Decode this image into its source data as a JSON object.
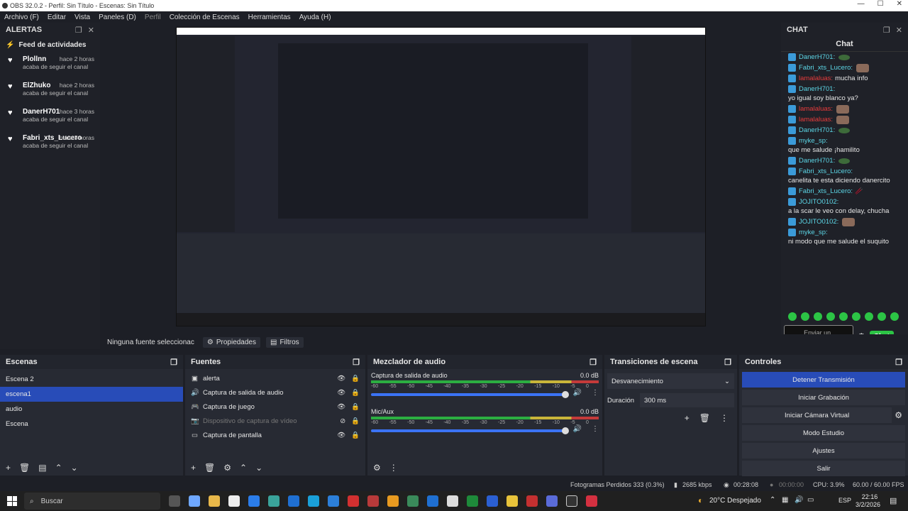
{
  "window": {
    "title": "OBS 32.0.2 - Perfil: Sin Título - Escenas: Sin Título"
  },
  "menu": [
    "Archivo (F)",
    "Editar",
    "Vista",
    "Paneles (D)",
    "Perfil",
    "Colección de Escenas",
    "Herramientas",
    "Ayuda (H)"
  ],
  "alertas": {
    "dock_title": "ALERTAS",
    "feed_title": "Feed de actividades",
    "items": [
      {
        "name": "Plollnn",
        "time": "hace 2 horas",
        "sub": "acaba de seguir el canal"
      },
      {
        "name": "ElZhuko",
        "time": "hace 2 horas",
        "sub": "acaba de seguir el canal"
      },
      {
        "name": "DanerH701",
        "time": "hace 3 horas",
        "sub": "acaba de seguir el canal"
      },
      {
        "name": "Fabri_xts_Lucero",
        "time": "hace 3 horas",
        "sub": "acaba de seguir el canal"
      }
    ]
  },
  "chat": {
    "dock_title": "CHAT",
    "title": "Chat",
    "messages": [
      {
        "user": "DanerH701:",
        "text": "",
        "emote": "green"
      },
      {
        "user": "Fabri_xts_Lucero:",
        "text": "",
        "emote": "face"
      },
      {
        "user": "lamalaluas:",
        "text": "mucha info",
        "red": true
      },
      {
        "user": "DanerH701:",
        "text": "yo igual soy blanco ya?"
      },
      {
        "user": "lamalaluas:",
        "text": "",
        "emote": "face",
        "red": true
      },
      {
        "user": "lamalaluas:",
        "text": "",
        "emote": "face",
        "red": true
      },
      {
        "user": "DanerH701:",
        "text": "",
        "emote": "green"
      },
      {
        "user": "myke_sp:",
        "text": "que me salude ¡hamilito"
      },
      {
        "user": "DanerH701:",
        "text": "",
        "emote": "green"
      },
      {
        "user": "Fabri_xts_Lucero:",
        "text": "canelita te esta diciendo danercito"
      },
      {
        "user": "Fabri_xts_Lucero:",
        "text": "🥢"
      },
      {
        "user": "JOJITO0102:",
        "text": "a la scar le veo con delay, chucha"
      },
      {
        "user": "JOJITO0102:",
        "text": "",
        "emote": "face"
      },
      {
        "user": "myke_sp:",
        "text": "ni modo que me salude el suquito"
      }
    ],
    "input_placeholder": "Enviar un mensaje",
    "send_label": "Chat"
  },
  "properties_bar": {
    "source": "Ninguna fuente seleccionac",
    "props": "Propiedades",
    "filters": "Filtros"
  },
  "scenes": {
    "title": "Escenas",
    "items": [
      "Escena 2",
      "escena1",
      "audio",
      "Escena"
    ],
    "selected": 1
  },
  "sources": {
    "title": "Fuentes",
    "items": [
      {
        "icon": "image",
        "label": "alerta",
        "disabled": false
      },
      {
        "icon": "speaker",
        "label": "Captura de salida de audio",
        "disabled": false
      },
      {
        "icon": "gamepad",
        "label": "Captura de juego",
        "disabled": false
      },
      {
        "icon": "camera",
        "label": "Dispositivo de captura de vídeo",
        "disabled": true
      },
      {
        "icon": "monitor",
        "label": "Captura de pantalla",
        "disabled": false
      }
    ]
  },
  "mixer": {
    "title": "Mezclador de audio",
    "channels": [
      {
        "name": "Captura de salida de audio",
        "level": "0.0 dB"
      },
      {
        "name": "Mic/Aux",
        "level": "0.0 dB"
      }
    ],
    "scale": [
      "-60",
      "-55",
      "-50",
      "-45",
      "-40",
      "-35",
      "-30",
      "-25",
      "-20",
      "-15",
      "-10",
      "-5",
      "0"
    ]
  },
  "transitions": {
    "title": "Transiciones de escena",
    "type": "Desvanecimiento",
    "duration_label": "Duración",
    "duration": "300 ms"
  },
  "controls": {
    "title": "Controles",
    "buttons": [
      "Detener Transmisión",
      "Iniciar Grabación",
      "Iniciar Cámara Virtual",
      "Modo Estudio",
      "Ajustes",
      "Salir"
    ]
  },
  "status": {
    "dropped": "Fotogramas Perdidos 333 (0.3%)",
    "bitrate": "2685 kbps",
    "live_time": "00:28:08",
    "rec_time": "00:00:00",
    "cpu": "CPU: 3.9%",
    "fps": "60.00 / 60.00 FPS"
  },
  "taskbar": {
    "search": "Buscar",
    "weather": "20°C  Despejado",
    "lang": "ESP",
    "time": "22:16",
    "date": "3/2/2026"
  }
}
